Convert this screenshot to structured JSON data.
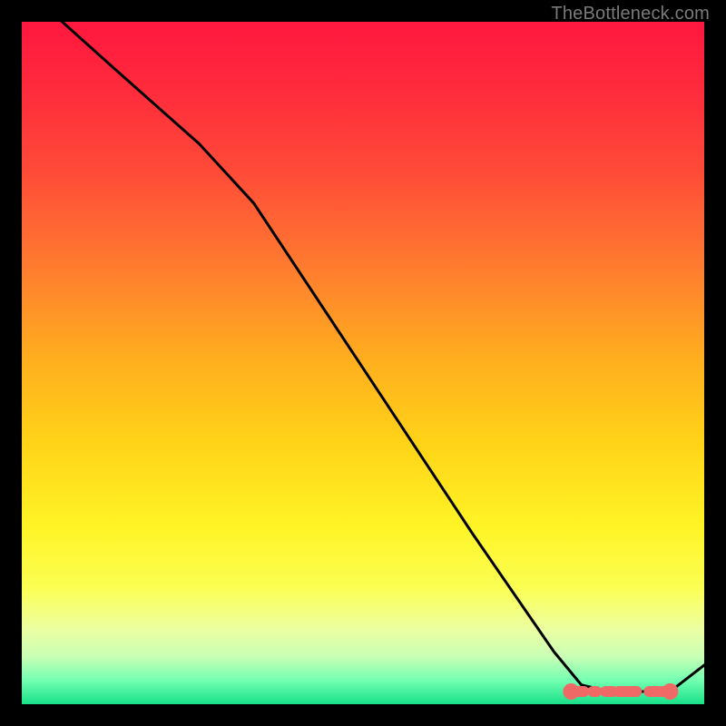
{
  "watermark": "TheBottleneck.com",
  "gradient_stops": [
    {
      "offset": 0.0,
      "color": "#ff173f"
    },
    {
      "offset": 0.1,
      "color": "#ff2b3c"
    },
    {
      "offset": 0.22,
      "color": "#ff4b38"
    },
    {
      "offset": 0.35,
      "color": "#ff7830"
    },
    {
      "offset": 0.5,
      "color": "#ffb01e"
    },
    {
      "offset": 0.62,
      "color": "#ffd418"
    },
    {
      "offset": 0.74,
      "color": "#fff426"
    },
    {
      "offset": 0.83,
      "color": "#fbff53"
    },
    {
      "offset": 0.89,
      "color": "#ecffa2"
    },
    {
      "offset": 0.93,
      "color": "#c9ffb5"
    },
    {
      "offset": 0.965,
      "color": "#73ffb1"
    },
    {
      "offset": 1.0,
      "color": "#18e089"
    }
  ],
  "curve_color": "#000000",
  "curve_width": 3.0,
  "marker_color": "#ef6a66",
  "marker_radius": 9,
  "marker_stroke": "#ef6a66",
  "marker_stroke_width": 20,
  "floor_start_x": 0.805,
  "floor_end_x": 0.94,
  "end_marker_x": 0.95,
  "chart_data": {
    "type": "line",
    "title": "",
    "xlabel": "",
    "ylabel": "",
    "xlim": [
      0,
      100
    ],
    "ylim": [
      0,
      100
    ],
    "x": [
      0,
      14,
      26,
      34,
      50,
      66,
      78,
      82,
      86,
      90,
      94,
      95,
      100
    ],
    "values": [
      107,
      94,
      83,
      74,
      49,
      24,
      6,
      1,
      0,
      0,
      0,
      0,
      4
    ],
    "note": "Values estimated from pixel positions; y is a percentage-like metric (bottleneck %) where 0 is at the bottom and ~100 at the top. The curve falls steeply, reaches ~0 around x≈82–94, then rises slightly at the right edge."
  }
}
